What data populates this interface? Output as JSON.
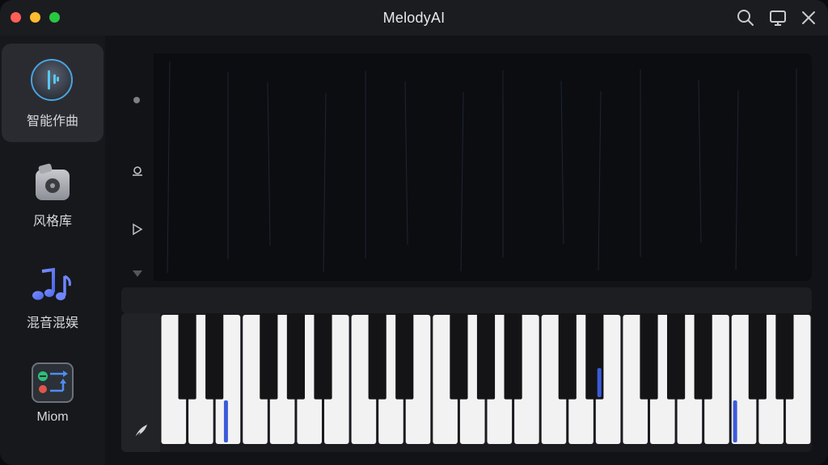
{
  "window": {
    "title": "MelodyAI",
    "controls": [
      "search-icon",
      "monitor-icon",
      "close-icon"
    ]
  },
  "sidebar": {
    "items": [
      {
        "label": "智能作曲",
        "icon": "ai-compose-icon",
        "active": true
      },
      {
        "label": "风格库",
        "icon": "style-library-icon",
        "active": false
      },
      {
        "label": "混音混娱",
        "icon": "music-notes-icon",
        "active": false
      },
      {
        "label": "Miom",
        "icon": "mixer-board-icon",
        "active": false
      }
    ]
  },
  "waveform": {
    "tools": [
      "dot-icon",
      "loop-icon",
      "play-icon",
      "down-arrow-icon"
    ],
    "gradient_colors": [
      "#8b5cf6",
      "#4fa6e6",
      "#2bd4c4",
      "#8b5cf6"
    ]
  },
  "piano": {
    "tool_icon": "quill-pen-icon",
    "highlight_color": "#3b5bdb",
    "white_keys": 24
  },
  "colors": {
    "accent": "#3b5bdb",
    "wave_purple": "#8b5cf6",
    "wave_cyan": "#2bd4c4"
  }
}
